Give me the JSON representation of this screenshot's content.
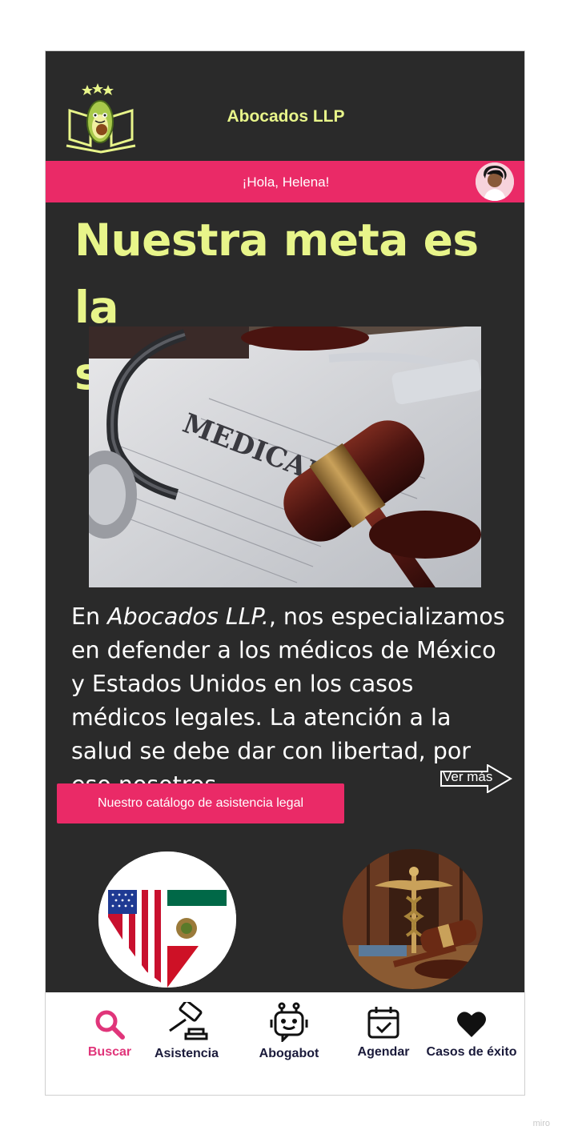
{
  "header": {
    "brand": "Abocados LLP",
    "logo_icon": "avocado-lawyer-logo",
    "greeting": "¡Hola, Helena!",
    "avatar_icon": "user-avatar"
  },
  "hero": {
    "headline_line1": "Nuestra meta es la",
    "headline_line2": "salud",
    "image_icon": "gavel-stethoscope-medical-form-photo"
  },
  "intro": {
    "prefix": "En ",
    "company": "Abocados LLP.",
    "text": ", nos especializamos en defender a los médicos de México y Estados Unidos en los casos médicos legales. La atención a la salud se debe dar con libertad, por eso nosotros....",
    "read_more": "Ver más"
  },
  "cta": {
    "label": "Nuestro catálogo de asistencia legal"
  },
  "features": [
    {
      "icon": "usa-mexico-flags"
    },
    {
      "icon": "caduceus-gavel-photo"
    }
  ],
  "nav": [
    {
      "label": "Buscar",
      "icon": "search-icon",
      "active": true
    },
    {
      "label": "Asistencia",
      "icon": "gavel-icon"
    },
    {
      "label": "Abogabot",
      "icon": "robot-icon"
    },
    {
      "label": "Agendar",
      "icon": "calendar-icon"
    },
    {
      "label": "Casos de éxito",
      "icon": "heart-icon"
    }
  ],
  "colors": {
    "accent": "#ea2a67",
    "brand_yellow": "#e8f58a",
    "dark_bg": "#2a2a2a",
    "nav_active": "#e0357a"
  },
  "watermark": "miro"
}
